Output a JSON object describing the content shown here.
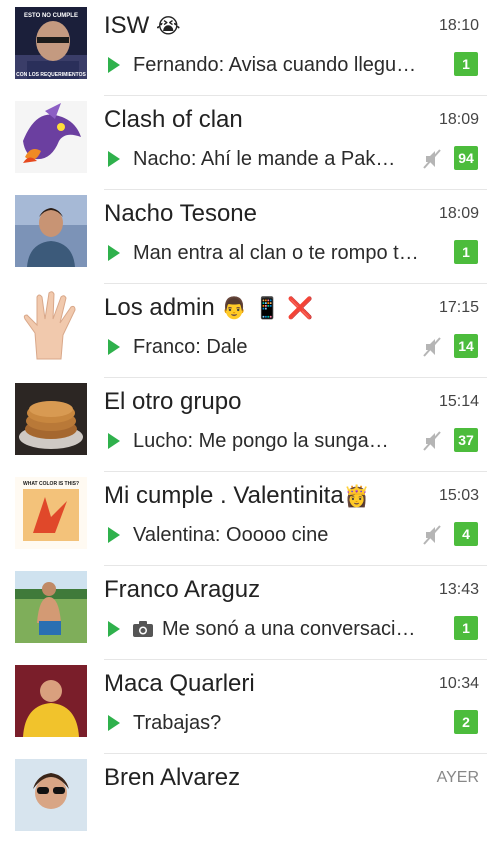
{
  "chats": [
    {
      "name": "ISW",
      "emoji": "😭",
      "time": "18:10",
      "snippet": "Fernando: Avisa cuando llegu…",
      "badge": "1",
      "muted": false,
      "avatar": "bald-man-meme-avatar"
    },
    {
      "name": "Clash of clan",
      "emoji": "",
      "time": "18:09",
      "snippet": "Nacho: Ahí le mande a Pak…",
      "badge": "94",
      "muted": true,
      "avatar": "dragon-avatar"
    },
    {
      "name": "Nacho Tesone",
      "emoji": "",
      "time": "18:09",
      "snippet": "Man entra al clan o te rompo t…",
      "badge": "1",
      "muted": false,
      "avatar": "young-man-avatar"
    },
    {
      "name": "Los admin",
      "emoji": "👨 📱 ❌",
      "time": "17:15",
      "snippet": "Franco: Dale",
      "badge": "14",
      "muted": true,
      "avatar": "hand-avatar"
    },
    {
      "name": "El otro grupo",
      "emoji": "",
      "time": "15:14",
      "snippet": "Lucho: Me pongo la sunga…",
      "badge": "37",
      "muted": true,
      "avatar": "pancakes-avatar"
    },
    {
      "name": "Mi cumple . Valentinita",
      "emoji": "👸",
      "time": "15:03",
      "snippet": "Valentina: Ooooo cine",
      "badge": "4",
      "muted": true,
      "avatar": "what-color-dress-avatar",
      "avatar_text": "WHAT COLOR IS THIS?"
    },
    {
      "name": "Franco Araguz",
      "emoji": "",
      "time": "13:43",
      "snippet": "Me sonó a una conversaci…",
      "badge": "1",
      "muted": false,
      "camera": true,
      "avatar": "shirtless-boy-avatar"
    },
    {
      "name": "Maca Quarleri",
      "emoji": "",
      "time": "10:34",
      "snippet": "Trabajas?",
      "badge": "2",
      "muted": false,
      "avatar": "girl-yellow-avatar"
    },
    {
      "name": "Bren Alvarez",
      "emoji": "",
      "time": "AYER",
      "snippet": "",
      "badge": "",
      "muted": false,
      "avatar": "woman-sunglasses-avatar"
    }
  ],
  "avatar_texts": {
    "isw_top": "ESTO NO CUMPLE",
    "isw_bottom": "CON LOS REQUERIMIENTOS"
  },
  "colors": {
    "accent": "#2fb14c",
    "badge": "#4cbc3c",
    "divider": "#e6e6e6",
    "mute": "#b5b5b5"
  }
}
